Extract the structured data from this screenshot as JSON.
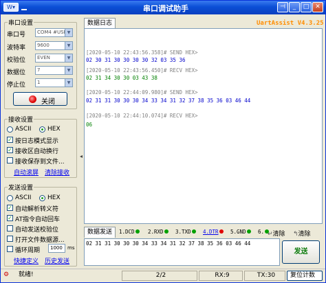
{
  "window": {
    "title": "串口调试助手"
  },
  "brand": "UartAssist V4.3.25",
  "serial": {
    "group_title": "串口设置",
    "port_label": "串口号",
    "port_value": "COM4 #USI",
    "baud_label": "波特率",
    "baud_value": "9600",
    "parity_label": "校验位",
    "parity_value": "EVEN",
    "databits_label": "数据位",
    "databits_value": "7",
    "stopbits_label": "停止位",
    "stopbits_value": "1",
    "close_label": "关闭"
  },
  "recv": {
    "group_title": "接收设置",
    "ascii": "ASCII",
    "hex": "HEX",
    "opt1": "按日志模式显示",
    "opt2": "接收区自动换行",
    "opt3": "接收保存到文件...",
    "link_autoscroll": "自动滚屏",
    "link_clear": "清除接收"
  },
  "send": {
    "group_title": "发送设置",
    "ascii": "ASCII",
    "hex": "HEX",
    "opt1": "自动解析转义符",
    "opt2": "AT指令自动回车",
    "opt3": "自动发送校验位",
    "opt4": "打开文件数据源...",
    "opt5": "循环周期",
    "period": "1000",
    "unit": "ms",
    "link_shortcut": "快捷定义",
    "link_history": "历史发送"
  },
  "log_tab": "数据日志",
  "log": [
    {
      "text": "[2020-05-10 22:43:56.358]# SEND HEX>",
      "color": "#808080"
    },
    {
      "text": "02 30 31 30 30 30 30 32 03 35 36",
      "color": "#0000cc"
    },
    {
      "text": "[2020-05-10 22:43:56.450]# RECV HEX>",
      "color": "#808080"
    },
    {
      "text": "02 31 34 30 30 03 43 38",
      "color": "#008000"
    },
    {
      "text": "[2020-05-10 22:44:09.980]# SEND HEX>",
      "color": "#808080"
    },
    {
      "text": "02 31 31 30 30 30 34 33 34 31 32 37 38 35 36 03 46 44",
      "color": "#0000cc"
    },
    {
      "text": "[2020-05-10 22:44:10.074]# RECV HEX>",
      "color": "#808080"
    },
    {
      "text": "06",
      "color": "#008000"
    }
  ],
  "send_tab": "数据发送",
  "signals": [
    {
      "label": "1.DCD",
      "color": "#00a000"
    },
    {
      "label": "2.RXD",
      "color": "#00a000"
    },
    {
      "label": "3.TXD",
      "color": "#00a000"
    },
    {
      "label": "4.DTR",
      "color": "#e00000"
    },
    {
      "label": "5.GND",
      "color": "#00a000"
    },
    {
      "label": "6.",
      "color": "#00a000"
    }
  ],
  "clear_send1": "清除",
  "clear_send2": "清除",
  "send_data": "02 31 31 30 30 30 34 33 34 31 32 37 38 35 36 03 46 44",
  "send_button": "发送",
  "status": {
    "state": "就绪!",
    "progress": "2/2",
    "rx": "RX:9",
    "tx": "TX:30",
    "reset": "复位计数"
  }
}
